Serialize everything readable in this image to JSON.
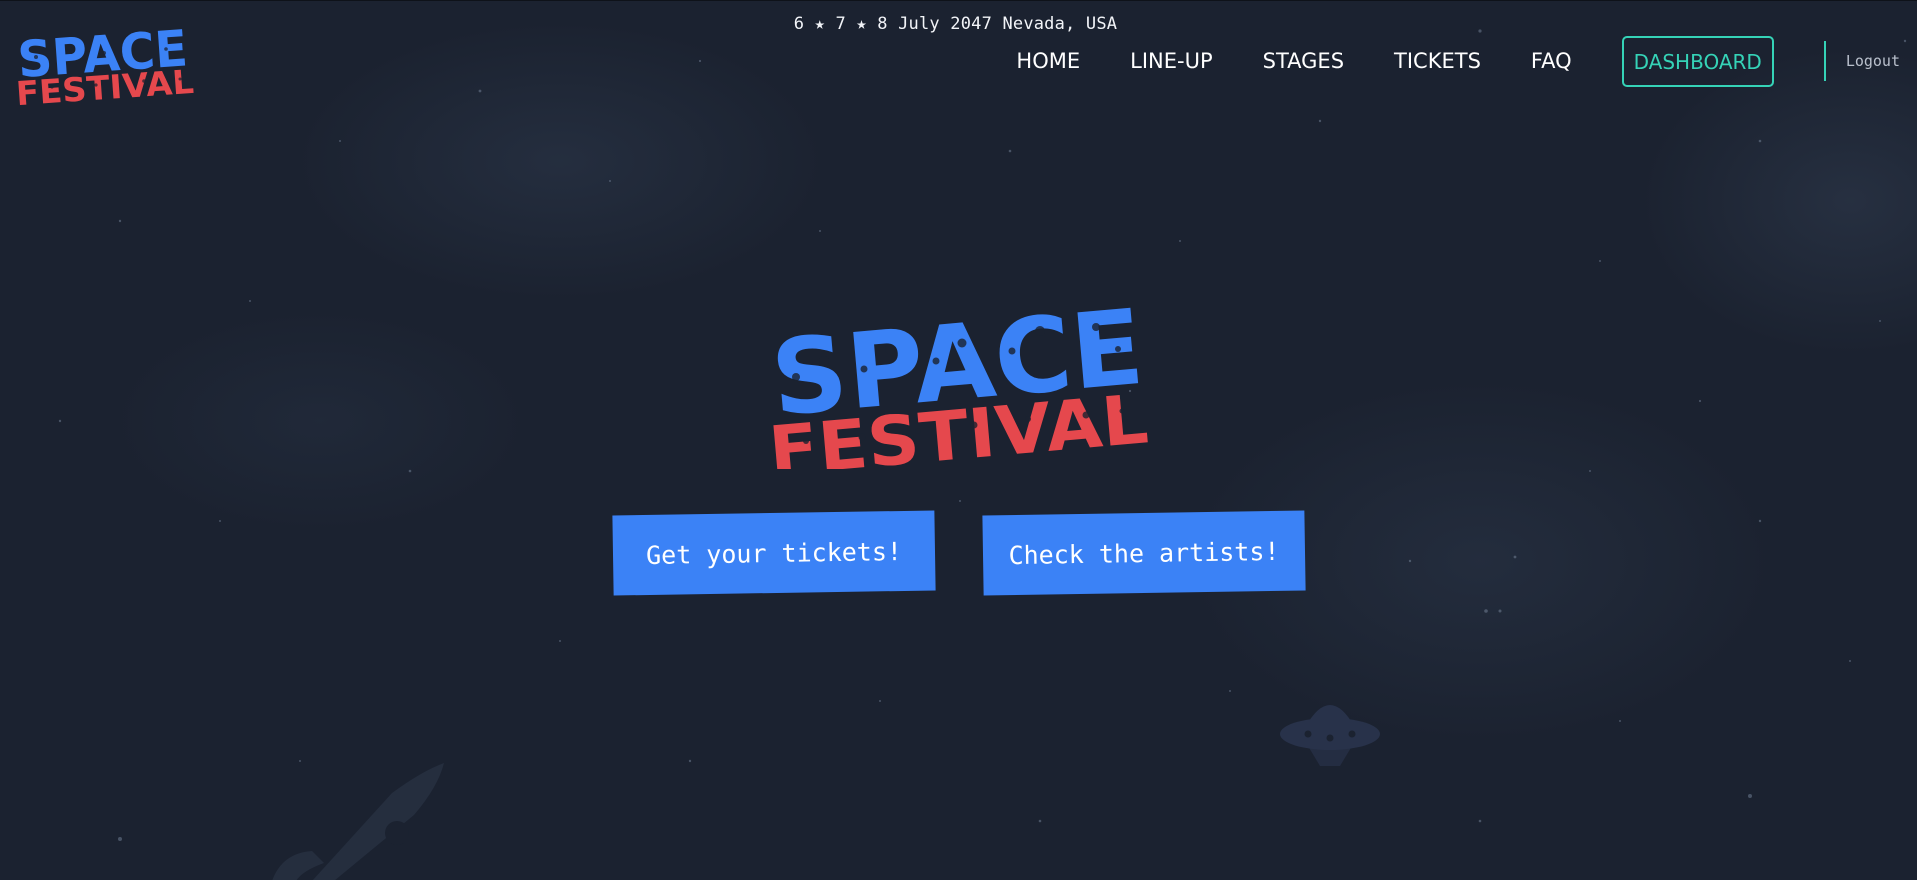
{
  "header": {
    "event_info": "6 ★ 7 ★ 8 July 2047 Nevada, USA",
    "logo": {
      "line1": "SPACE",
      "line2": "FESTIVAL"
    }
  },
  "nav": {
    "items": [
      {
        "label": "HOME"
      },
      {
        "label": "LINE-UP"
      },
      {
        "label": "STAGES"
      },
      {
        "label": "TICKETS"
      },
      {
        "label": "FAQ"
      }
    ],
    "dashboard_label": "DASHBOARD",
    "logout_label": "Logout"
  },
  "hero": {
    "logo": {
      "line1": "SPACE",
      "line2": "FESTIVAL"
    },
    "cta_tickets": "Get your tickets!",
    "cta_artists": "Check the artists!"
  },
  "colors": {
    "background": "#1b2230",
    "brand_blue": "#3b82f6",
    "brand_red": "#e5484d",
    "accent_teal": "#35d3b7"
  },
  "icons": [
    "rocket-icon",
    "ufo-icon"
  ]
}
